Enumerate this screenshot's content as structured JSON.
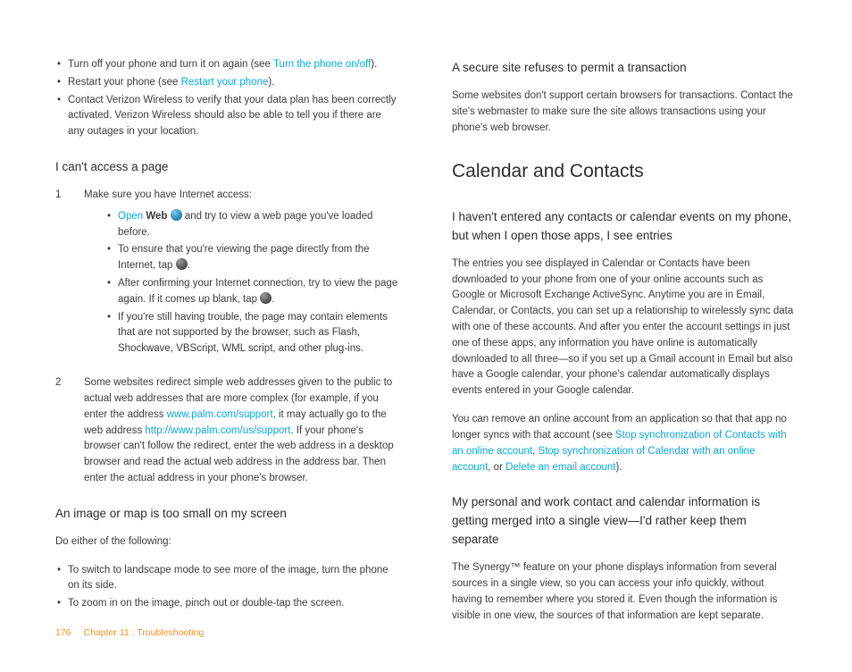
{
  "left": {
    "top_bullets": [
      {
        "pre": "Turn off your phone and turn it on again (see ",
        "link": "Turn the phone on/off",
        "post": ")."
      },
      {
        "pre": "Restart your phone (see ",
        "link": "Restart your phone",
        "post": ")."
      },
      {
        "plain": "Contact Verizon Wireless to verify that your data plan has been correctly activated. Verizon Wireless should also be able to tell you if there are any outages in your location."
      }
    ],
    "h1": "I can't access a page",
    "step1_num": "1",
    "step1_text": "Make sure you have Internet access:",
    "step1_b1_open": "Open",
    "step1_b1_web": "Web",
    "step1_b1_rest": " and try to view a web page you've loaded before.",
    "step1_b2a": "To ensure that you're viewing the page directly from the Internet, tap ",
    "step1_b2b": ".",
    "step1_b3a": "After confirming your Internet connection, try to view the page again. If it comes up blank, tap ",
    "step1_b3b": ".",
    "step1_b4": "If you're still having trouble, the page may contain elements that are not supported by the browser, such as Flash, Shockwave, VBScript, WML script, and other plug-ins.",
    "step2_num": "2",
    "step2_a": "Some websites redirect simple web addresses given to the public to actual web addresses that are more complex (for example, if you enter the address ",
    "step2_link1": "www.palm.com/support",
    "step2_b": ", it may actually go to the web address ",
    "step2_link2": "http://www.palm.com/us/support",
    "step2_c": ". If your phone's browser can't follow the redirect, enter the web address in a desktop browser and read the actual web address in the address bar. Then enter the actual address in your phone's browser.",
    "h2": "An image or map is too small on my screen",
    "do_either": "Do either of the following:",
    "img_b1": "To switch to landscape mode to see more of the image, turn the phone on its side.",
    "img_b2": "To zoom in on the image, pinch out or double-tap the screen."
  },
  "right": {
    "h1": "A secure site refuses to permit a transaction",
    "p1": "Some websites don't support certain browsers for transactions. Contact the site's webmaster to make sure the site allows transactions using your phone's web browser.",
    "hmain": "Calendar and Contacts",
    "h2": "I haven't entered any contacts or calendar events on my phone, but when I open those apps, I see entries",
    "p2": "The entries you see displayed in Calendar or Contacts have been downloaded to your phone from one of your online accounts such as Google or Microsoft Exchange ActiveSync. Anytime you are in Email, Calendar, or Contacts, you can set up a relationship to wirelessly sync data with one of these accounts. And after you enter the account settings in just one of these apps, any information you have online is automatically downloaded to all three—so if you set up a Gmail account in Email but also have a Google calendar, your phone's calendar automatically displays events entered in your Google calendar.",
    "p3a": "You can remove an online account from an application so that that app no longer syncs with that account (see ",
    "p3_l1": "Stop synchronization of Contacts with an online account",
    "p3b": ", ",
    "p3_l2": "Stop synchronization of Calendar with an online account",
    "p3c": ", or ",
    "p3_l3": "Delete an email account",
    "p3d": ").",
    "h3": "My personal and work contact and calendar information is getting merged into a single view—I'd rather keep them separate",
    "p4": "The Synergy™ feature on your phone displays information from several sources in a single view, so you can access your info quickly, without having to remember where you stored it. Even though the information is visible in one view, the sources of that information are kept separate."
  },
  "footer": {
    "page": "176",
    "chapter": "Chapter 11 : Troubleshooting"
  }
}
